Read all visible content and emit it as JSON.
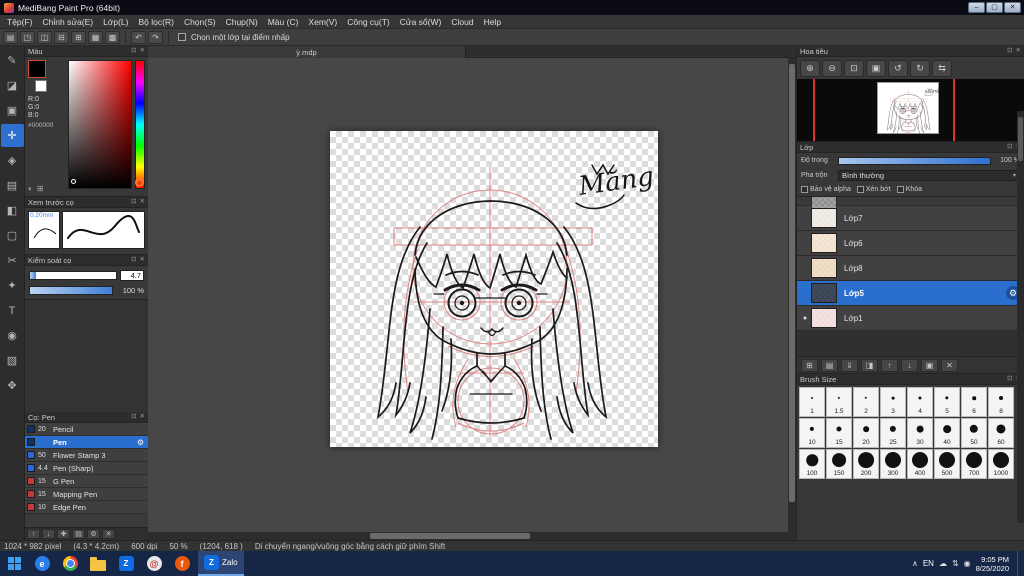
{
  "ui": {
    "float_icon": "⊡",
    "close_icon": "✕",
    "dropdown_caret": "▾",
    "gear_icon": "⚙",
    "eye_dot": "●",
    "tray_caret": "∧",
    "window_min": "–",
    "window_max": "▢",
    "window_close": "✕"
  },
  "window": {
    "title": "MediBang Paint Pro (64bit)"
  },
  "menu": {
    "items": [
      "Tệp(F)",
      "Chỉnh sửa(E)",
      "Lớp(L)",
      "Bộ lọc(R)",
      "Chọn(S)",
      "Chụp(N)",
      "Màu (C)",
      "Xem(V)",
      "Công cụ(T)",
      "Cửa sổ(W)",
      "Cloud",
      "Help"
    ]
  },
  "toolbar": {
    "checkbox_label": "Chọn một lớp tại điểm nhấp",
    "undo": "↶",
    "redo": "↷",
    "icons": [
      {
        "name": "new-file-icon",
        "glyph": "▤"
      },
      {
        "name": "open-file-icon",
        "glyph": "◳"
      },
      {
        "name": "save-icon",
        "glyph": "◫"
      },
      {
        "name": "export-icon",
        "glyph": "⊟"
      },
      {
        "name": "grid-icon",
        "glyph": "⊞"
      },
      {
        "name": "ruler-icon",
        "glyph": "▦"
      },
      {
        "name": "material-icon",
        "glyph": "▩"
      }
    ]
  },
  "tools": {
    "active_index": 3,
    "items": [
      {
        "name": "brush-tool",
        "glyph": "✎"
      },
      {
        "name": "eraser-tool",
        "glyph": "◪"
      },
      {
        "name": "dot-pen-tool",
        "glyph": "▣"
      },
      {
        "name": "move-tool",
        "glyph": "✛"
      },
      {
        "name": "fill-tool",
        "glyph": "◈"
      },
      {
        "name": "bucket-tool",
        "glyph": "▤"
      },
      {
        "name": "gradient-tool",
        "glyph": "◧"
      },
      {
        "name": "select-tool",
        "glyph": "▢"
      },
      {
        "name": "lasso-tool",
        "glyph": "✂"
      },
      {
        "name": "magic-wand-tool",
        "glyph": "✦"
      },
      {
        "name": "text-tool",
        "glyph": "T"
      },
      {
        "name": "eyedropper-tool",
        "glyph": "◉"
      },
      {
        "name": "pattern-tool",
        "glyph": "▧"
      },
      {
        "name": "hand-tool",
        "glyph": "✥"
      }
    ]
  },
  "left_panels": {
    "color": {
      "title": "Màu",
      "r": "R:0",
      "g": "G:0",
      "b": "B:0",
      "hex": "#000000"
    },
    "stroke_preview": {
      "title": "Xem trước cọ",
      "size_label": "0.20mm"
    },
    "brush_control": {
      "title": "Kiểm soát cọ",
      "width_value": "4.7",
      "opacity_value": "100 %"
    },
    "brush_list": {
      "title": "Cọ: Pen",
      "items": [
        {
          "size": "20",
          "name": "Pencil",
          "chip": "#14305e",
          "selected": false
        },
        {
          "size": "",
          "name": "Pen",
          "chip": "#14305e",
          "selected": true
        },
        {
          "size": "50",
          "name": "Flower Stamp 3",
          "chip": "#2b66d9",
          "selected": false
        },
        {
          "size": "4.4",
          "name": "Pen (Sharp)",
          "chip": "#2b66d9",
          "selected": false
        },
        {
          "size": "15",
          "name": "G Pen",
          "chip": "#c23a3a",
          "selected": false
        },
        {
          "size": "15",
          "name": "Mapping Pen",
          "chip": "#c23a3a",
          "selected": false
        },
        {
          "size": "10",
          "name": "Edge Pen",
          "chip": "#c23a3a",
          "selected": false
        }
      ],
      "toolbar_icons": [
        {
          "name": "brush-up-icon",
          "glyph": "↑"
        },
        {
          "name": "brush-down-icon",
          "glyph": "↓"
        },
        {
          "name": "add-brush-icon",
          "glyph": "✚"
        },
        {
          "name": "brush-folder-icon",
          "glyph": "▤"
        },
        {
          "name": "brush-settings-icon",
          "glyph": "⚙"
        },
        {
          "name": "delete-brush-icon",
          "glyph": "✕"
        }
      ]
    }
  },
  "canvas": {
    "tab_label": "ỳ.mdp",
    "signature": "Măng"
  },
  "right_panels": {
    "navigator": {
      "title": "Hoa tiêu",
      "icons": [
        {
          "name": "zoom-in-icon",
          "glyph": "⊕"
        },
        {
          "name": "zoom-out-icon",
          "glyph": "⊖"
        },
        {
          "name": "zoom-fit-icon",
          "glyph": "⊡"
        },
        {
          "name": "zoom-actual-icon",
          "glyph": "▣"
        },
        {
          "name": "rotate-left-icon",
          "glyph": "↺"
        },
        {
          "name": "rotate-right-icon",
          "glyph": "↻"
        },
        {
          "name": "flip-icon",
          "glyph": "⇆"
        }
      ]
    },
    "layers": {
      "title": "Lớp",
      "opacity_label": "Độ trong",
      "opacity_value": "100 %",
      "blend_label": "Pha trộn",
      "blend_value": "Bình thường",
      "check_labels": [
        "Bảo vệ alpha",
        "Xén bớt",
        "Khóa"
      ],
      "items": [
        {
          "name": "Lớp7",
          "tint": "#efe9e2",
          "eye": false,
          "selected": false
        },
        {
          "name": "Lớp6",
          "tint": "#f3e3cd",
          "eye": false,
          "selected": false
        },
        {
          "name": "Lớp8",
          "tint": "#eed9bb",
          "eye": false,
          "selected": false
        },
        {
          "name": "Lớp5",
          "tint": "#1f2a3d",
          "eye": false,
          "selected": true
        },
        {
          "name": "Lớp1",
          "tint": "#f5dcdc",
          "eye": true,
          "selected": false
        }
      ],
      "toolbar_icons": [
        {
          "name": "add-layer-icon",
          "glyph": "⊞"
        },
        {
          "name": "add-folder-icon",
          "glyph": "▤"
        },
        {
          "name": "transfer-layer-icon",
          "glyph": "⇓"
        },
        {
          "name": "merge-layer-icon",
          "glyph": "◨"
        },
        {
          "name": "move-layer-up-icon",
          "glyph": "↑"
        },
        {
          "name": "move-layer-down-icon",
          "glyph": "↓"
        },
        {
          "name": "duplicate-layer-icon",
          "glyph": "▣"
        },
        {
          "name": "delete-layer-icon",
          "glyph": "✕"
        }
      ]
    },
    "brush_size": {
      "title": "Brush Size",
      "sizes": [
        1,
        1.5,
        2,
        3,
        4,
        5,
        6,
        8,
        10,
        15,
        20,
        25,
        30,
        40,
        50,
        60,
        100,
        150,
        200,
        300,
        400,
        500,
        700,
        1000
      ]
    }
  },
  "statusbar": {
    "size": "1024 * 982 pixel",
    "dimensions": "(4.3 * 4.2cm)",
    "dpi": "600 dpi",
    "zoom": "50 %",
    "coords": "(1204, 618 )",
    "hint": "Di chuyển ngang/vuông góc bằng cách giữ phím Shift"
  },
  "taskbar": {
    "items": [
      {
        "name": "start-button",
        "kind": "start"
      },
      {
        "name": "edge-icon",
        "kind": "circle",
        "color": "#2b7de9",
        "glyph": "e"
      },
      {
        "name": "chrome-icon",
        "kind": "chrome"
      },
      {
        "name": "explorer-icon",
        "kind": "folder"
      },
      {
        "name": "zalo-icon",
        "kind": "square",
        "color": "#0f6ce0",
        "glyph": "Z"
      },
      {
        "name": "mail-icon",
        "kind": "circle",
        "color": "#e8e8e8",
        "glyph": "@",
        "fg": "#c33"
      },
      {
        "name": "firefox-icon",
        "kind": "circle",
        "color": "#e8590c",
        "glyph": "f"
      }
    ],
    "active_label": "Zalo",
    "tray": {
      "lang": "EN",
      "time": "9:05 PM",
      "date": "8/25/2020",
      "icons": [
        {
          "name": "cloud-icon",
          "glyph": "☁"
        },
        {
          "name": "network-icon",
          "glyph": "⇅"
        },
        {
          "name": "volume-icon",
          "glyph": "◉"
        }
      ]
    }
  }
}
